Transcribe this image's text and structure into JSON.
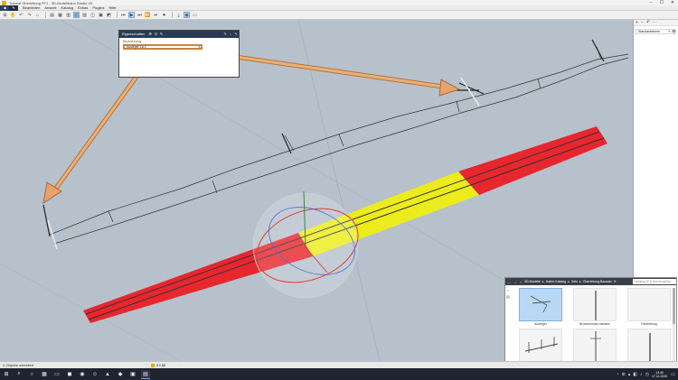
{
  "window": {
    "title": "Tutorial Oberleitung FF1 - 3D-Modellbahn Studio V6",
    "controls": [
      "–",
      "☐",
      "✕"
    ]
  },
  "menu": {
    "tabs": [
      "◀",
      "✎"
    ],
    "items": [
      "Bearbeiten",
      "Ansicht",
      "Katalog",
      "Extras",
      "Plugins",
      "Hilfe"
    ]
  },
  "toolbar": {
    "icons": [
      "⊞",
      "✋",
      "↶",
      "↷",
      "⌂",
      "▤",
      "▦",
      "▥",
      "▧",
      "▨",
      "◫",
      "▣",
      "◩",
      "⏮",
      "▶",
      "⏭",
      "⏩",
      "⏯",
      "⏺",
      "⤓",
      "◉",
      "▭"
    ]
  },
  "properties": {
    "title": "Eigenschaften",
    "header_icons": [
      "⚙",
      "⚲",
      "✎"
    ],
    "right_icons": [
      "✎",
      "⇔",
      "✎"
    ],
    "field_label": "Bezeichnung",
    "field_value": "Ausleger 1a 2",
    "field_chevron": "▾"
  },
  "right_panel": {
    "header_icons": [
      "+",
      "−",
      "↶",
      "⋯"
    ],
    "item_label": "Standardebene",
    "item_icons": [
      "✎",
      "👁"
    ]
  },
  "catalog": {
    "nav": [
      "←",
      "→",
      "↑"
    ],
    "breadcrumb": [
      "3D-Modelle",
      "▸",
      "Haber-Katalog",
      "▸",
      "Sets",
      "▸",
      "Oberleitung-Bausatz"
    ],
    "refresh_icon": "⟳",
    "search_placeholder": "Katalog (F1) durchsuchen",
    "side_icons": [
      "☆",
      "▤"
    ],
    "items": [
      {
        "name": "Ausleger"
      },
      {
        "name": "Brückenmast variabel"
      },
      {
        "name": "Fahrleitung"
      },
      {
        "name": "Hochspannung 3 Pfeiler"
      },
      {
        "name": "Quertragwerk"
      },
      {
        "name": "Streckenmasten"
      }
    ]
  },
  "status": {
    "left": "2 Objekte selektiert",
    "coords": "42.88"
  },
  "taskbar": {
    "icons": [
      "⊞",
      "⌕",
      "○",
      "▦",
      "▭",
      "◼",
      "◉",
      "☺",
      "▲",
      "◆",
      "▣",
      "▤"
    ],
    "tray_icons": [
      "◔",
      "⊕",
      "▴",
      "◧",
      "♪",
      "◷"
    ],
    "time": "13:40",
    "date": "17.11.2020",
    "notify_icon": "▭"
  }
}
